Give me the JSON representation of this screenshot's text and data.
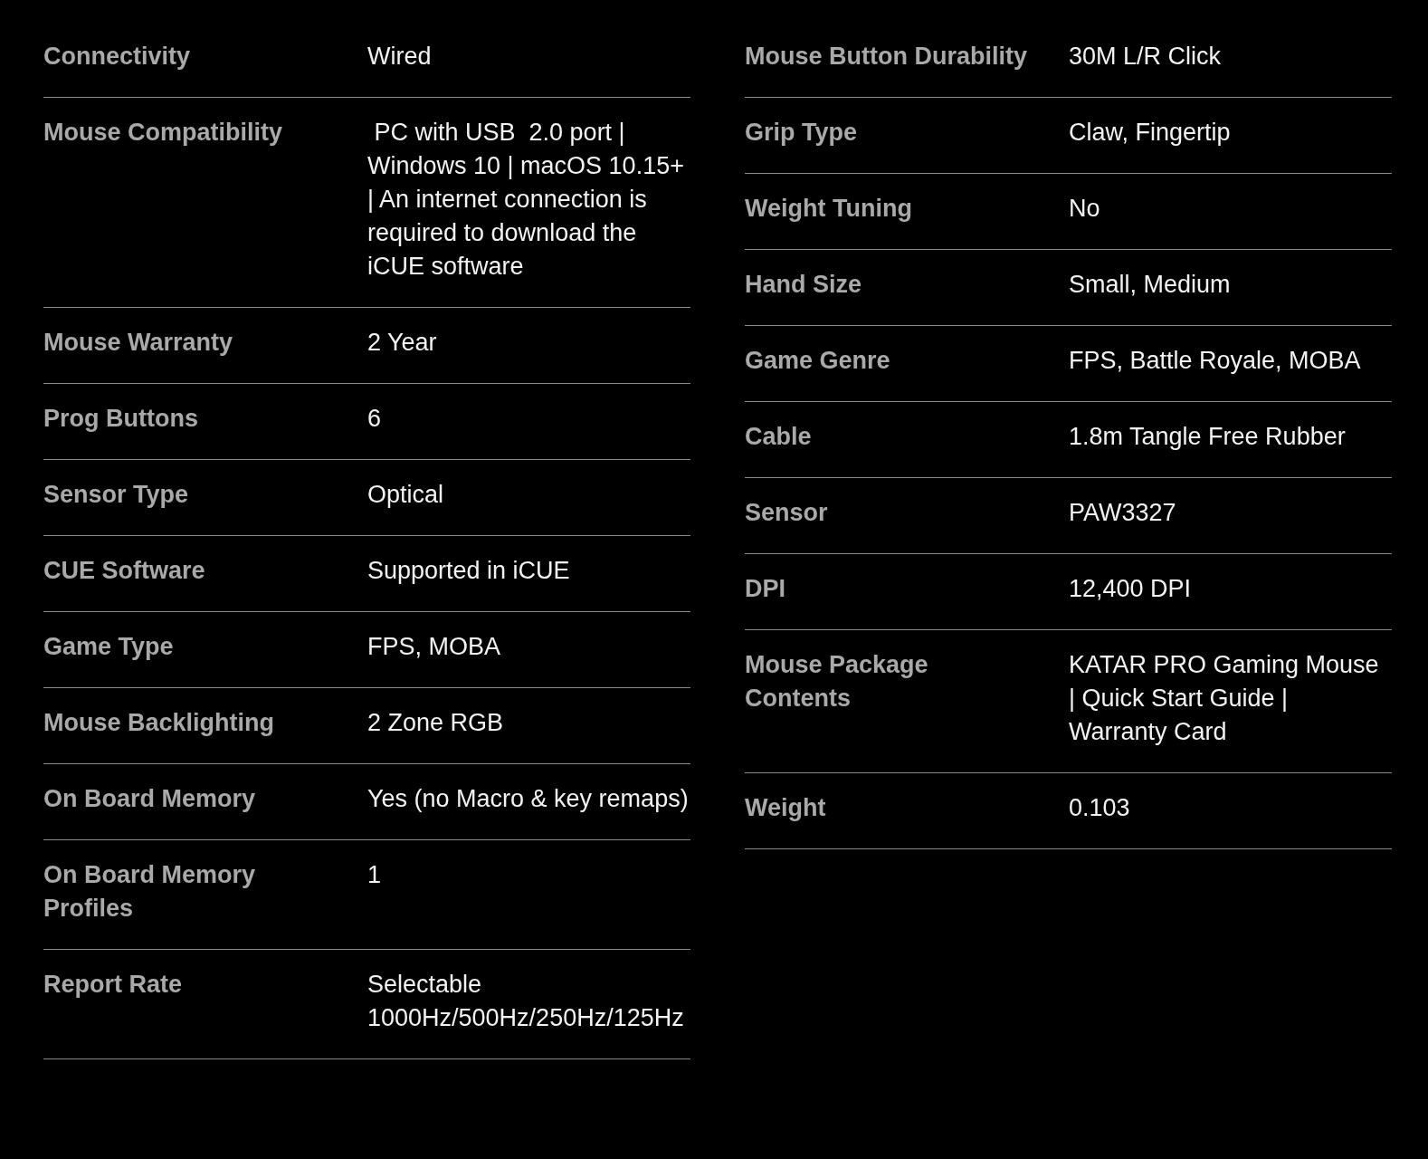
{
  "spec_columns": [
    {
      "rows": [
        {
          "label": "Connectivity",
          "value": "Wired"
        },
        {
          "label": "Mouse Compatibility",
          "value": " PC with USB  2.0 port | Windows 10 | macOS 10.15+ | An internet connection is required to download the iCUE software"
        },
        {
          "label": "Mouse Warranty",
          "value": "2 Year"
        },
        {
          "label": "Prog Buttons",
          "value": "6"
        },
        {
          "label": "Sensor Type",
          "value": "Optical"
        },
        {
          "label": "CUE Software",
          "value": "Supported in iCUE"
        },
        {
          "label": "Game Type",
          "value": "FPS, MOBA"
        },
        {
          "label": "Mouse Backlighting",
          "value": "2 Zone RGB"
        },
        {
          "label": "On Board Memory",
          "value": "Yes (no Macro & key remaps)"
        },
        {
          "label": "On Board Memory Profiles",
          "value": "1"
        },
        {
          "label": "Report Rate",
          "value": "Selectable 1000Hz/500Hz/250Hz/125Hz"
        }
      ]
    },
    {
      "rows": [
        {
          "label": "Mouse Button Durability",
          "value": "30M L/R Click"
        },
        {
          "label": "Grip Type",
          "value": "Claw, Fingertip"
        },
        {
          "label": "Weight Tuning",
          "value": "No"
        },
        {
          "label": "Hand Size",
          "value": "Small, Medium"
        },
        {
          "label": "Game Genre",
          "value": "FPS, Battle Royale, MOBA"
        },
        {
          "label": "Cable",
          "value": "1.8m Tangle Free Rubber"
        },
        {
          "label": "Sensor",
          "value": "PAW3327"
        },
        {
          "label": "DPI",
          "value": "12,400 DPI"
        },
        {
          "label": "Mouse Package Contents",
          "value": "KATAR PRO Gaming Mouse | Quick Start Guide | Warranty Card"
        },
        {
          "label": "Weight",
          "value": "0.103"
        }
      ]
    }
  ]
}
